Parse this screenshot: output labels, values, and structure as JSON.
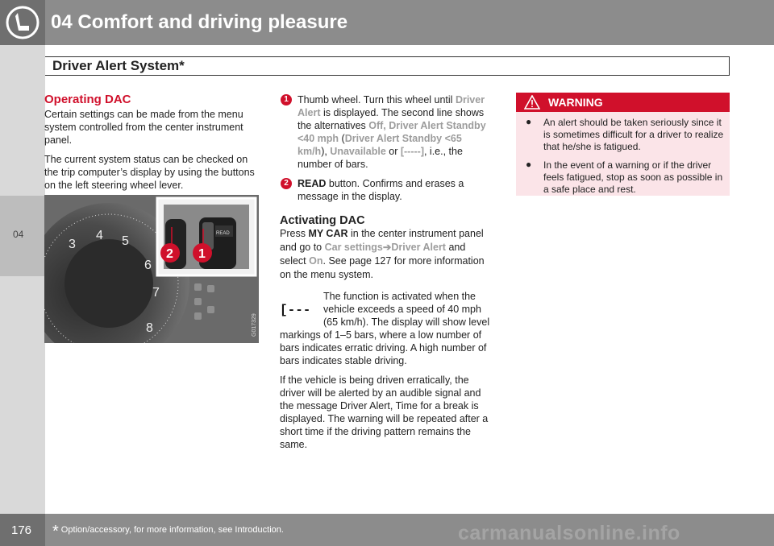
{
  "header": {
    "chapter_title": "04 Comfort and driving pleasure",
    "section_title": "Driver Alert System*"
  },
  "side_tab": {
    "label": "04"
  },
  "left_column": {
    "heading": "Operating DAC",
    "para1": "Certain settings can be made from the menu system controlled from the center instrument panel.",
    "para2": "The current system status can be checked on the trip computer’s display by using the buttons on the left steering wheel lever.",
    "image_code": "G017329",
    "callouts": [
      "2",
      "1"
    ]
  },
  "middle_column": {
    "item1": {
      "number": "1",
      "t1": "Thumb wheel. Turn this wheel until ",
      "h1": "Driver Alert",
      "t2": " is displayed. The second line shows the alternatives ",
      "h2": "Off, Driver Alert Standby <40 mph",
      "t3": " (",
      "h3": "Driver Alert Standby <65 km/h",
      "t4": "), ",
      "h4": "Unavailable",
      "t5": " or ",
      "h5": "[-----]",
      "t6": ", i.e., the number of bars."
    },
    "item2": {
      "number": "2",
      "bold": "READ",
      "text": " button. Confirms and erases a message in the display."
    },
    "heading": "Activating DAC",
    "activate": {
      "t1": "Press ",
      "b1": "MY CAR",
      "t2": " in the center instrument panel and go to ",
      "h1": "Car settings",
      "arrow": "➔",
      "h2": "Driver Alert",
      "t3": " and select ",
      "h3": "On",
      "t4": ". See page 127 for more information on the menu system."
    },
    "symbol_text": "[-‑- ]",
    "para_function": "The function is activated when the vehicle exceeds a speed of 40 mph (65 km/h). The display will show level markings of 1–5 bars, where a low number of bars indicates erratic driving. A high number of bars indicates stable driving.",
    "para_erratic": "If the vehicle is being driven erratically, the driver will be alerted by an audible signal and the message Driver Alert, Time for a break is displayed. The warning will be repeated after a short time if the driving pattern remains the same."
  },
  "warning": {
    "title": "WARNING",
    "items": [
      "An alert should be taken seriously since it is sometimes difficult for a driver to realize that he/she is fatigued.",
      "In the event of a warning or if the driver feels fatigued, stop as soon as possible in a safe place and rest."
    ]
  },
  "footer": {
    "page_number": "176",
    "footnote_star": "*",
    "footnote": "Option/accessory, for more information, see Introduction.",
    "watermark": "carmanualsonline.info"
  },
  "colors": {
    "accent_red": "#d0102b",
    "highlight_gray": "#9c9c9c",
    "header_gray": "#8c8c8c",
    "warning_bg": "#fbe4e8"
  }
}
